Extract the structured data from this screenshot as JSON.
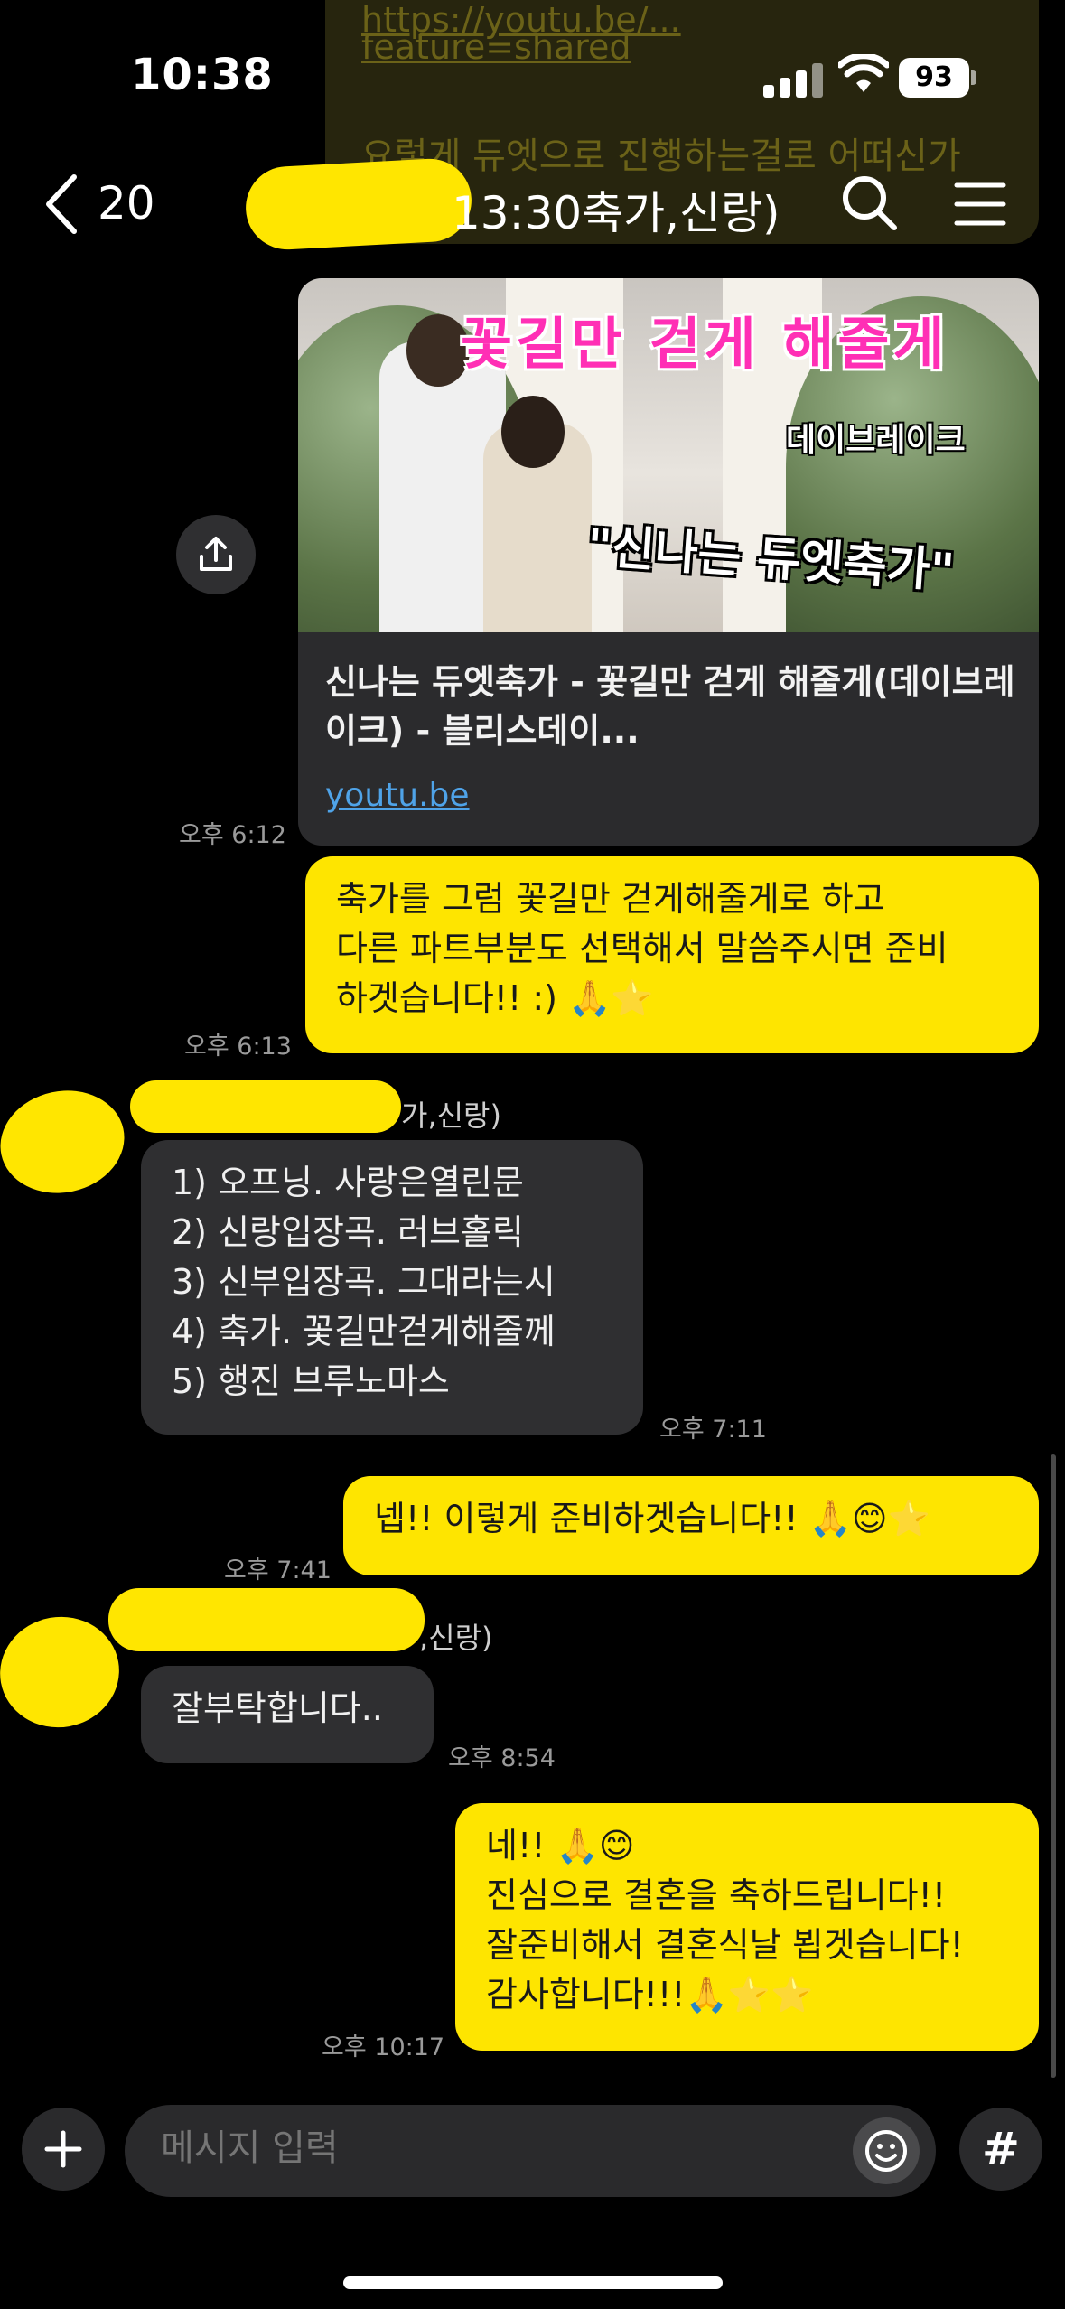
{
  "status": {
    "time": "10:38",
    "battery": "93"
  },
  "pinned": {
    "line1": "https://youtu.be/...",
    "line2": "feature=shared",
    "line3": "요렇게 듀엣으로 진행하는걸로 어떠신가"
  },
  "header": {
    "back_count": "20",
    "title": "13:30축가,신랑)"
  },
  "link_card": {
    "thumb_title": "꽃길만 걷게 해줄게",
    "thumb_artist": "데이브레이크",
    "thumb_quote": "\"신나는 듀엣축가\"",
    "title": "신나는 듀엣축가 - 꽃길만 걷게 해줄게(데이브레이크) - 블리스데이...",
    "domain": "youtu.be",
    "time": "오후 6:12"
  },
  "messages": [
    {
      "lines": [
        "축가를 그럼 꽃길만 걷게해줄게로 하고",
        "다른 파트부분도 선택해서 말씀주시면 준비",
        "하겟습니다!! :) 🙏⭐"
      ],
      "time": "오후 6:13"
    },
    {
      "sender": "가,신랑)",
      "lines": [
        "1) 오프닝.     사랑은열린문",
        "2) 신랑입장곡.  러브홀릭",
        "3) 신부입장곡.   그대라는시",
        "4) 축가.   꽃길만걷게해줄께",
        "5) 행진  브루노마스"
      ],
      "time": "오후 7:11"
    },
    {
      "lines": [
        "넵!! 이렇게 준비하겟습니다!! 🙏😊⭐"
      ],
      "time": "오후 7:41"
    },
    {
      "sender": ",신랑)",
      "lines": [
        "잘부탁합니다.."
      ],
      "time": "오후 8:54"
    },
    {
      "lines": [
        "네!! 🙏😊",
        "진심으로 결혼을 축하드립니다!!",
        "잘준비해서 결혼식날 뵙겟습니다!",
        "감사합니다!!!🙏⭐⭐"
      ],
      "time": "오후 10:17"
    }
  ],
  "input": {
    "placeholder": "메시지 입력"
  },
  "icons": {
    "back": "chevron-left-icon",
    "search": "search-icon",
    "menu": "menu-icon",
    "share": "share-icon",
    "plus": "plus-icon",
    "emoji": "emoji-icon",
    "hash": "#"
  },
  "colors": {
    "my_bubble": "#fee500",
    "other_bubble": "#2f2f31",
    "link": "#4fa3e8"
  }
}
